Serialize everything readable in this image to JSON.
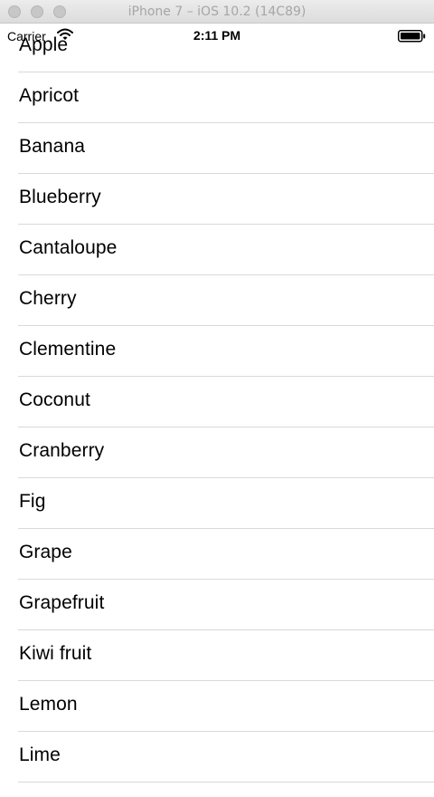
{
  "window": {
    "title": "iPhone 7 – iOS 10.2 (14C89)"
  },
  "status_bar": {
    "carrier": "Carrier",
    "time": "2:11 PM",
    "icons": [
      "wifi-icon",
      "battery-icon"
    ]
  },
  "fruits": [
    "Apple",
    "Apricot",
    "Banana",
    "Blueberry",
    "Cantaloupe",
    "Cherry",
    "Clementine",
    "Coconut",
    "Cranberry",
    "Fig",
    "Grape",
    "Grapefruit",
    "Kiwi fruit",
    "Lemon",
    "Lime"
  ],
  "colors": {
    "separator": "#d9d9dd",
    "text": "#000000",
    "background": "#ffffff"
  }
}
